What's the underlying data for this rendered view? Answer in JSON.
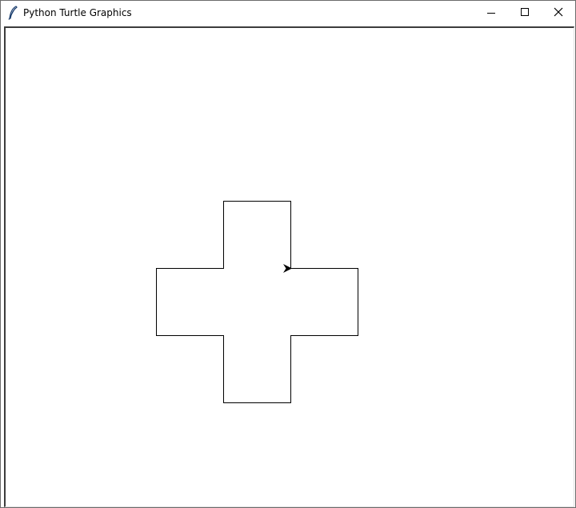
{
  "window": {
    "title": "Python Turtle Graphics",
    "app_icon": "feather-icon",
    "controls": {
      "minimize_icon": "minimize-icon",
      "maximize_icon": "maximize-icon",
      "close_icon": "close-icon"
    }
  },
  "canvas": {
    "background": "#ffffff",
    "pen_color": "#000000",
    "turtle_icon": "turtle-arrow-icon",
    "turtle_heading": "east"
  }
}
